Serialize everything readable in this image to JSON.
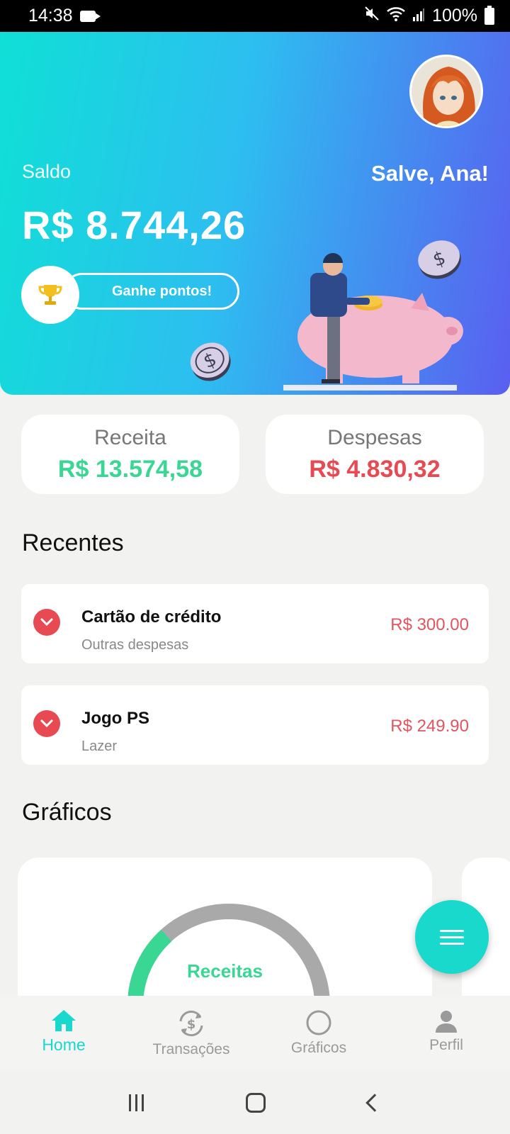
{
  "status": {
    "time": "14:38",
    "battery": "100%"
  },
  "header": {
    "balance_label": "Saldo",
    "greeting": "Salve, Ana!",
    "balance": "R$ 8.744,26",
    "points_button": "Ganhe pontos!"
  },
  "summary": {
    "income_label": "Receita",
    "income_value": "R$ 13.574,58",
    "expense_label": "Despesas",
    "expense_value": "R$ 4.830,32"
  },
  "recent": {
    "title": "Recentes",
    "items": [
      {
        "title": "Cartão de crédito",
        "category": "Outras despesas",
        "amount": "R$ 300.00"
      },
      {
        "title": "Jogo PS",
        "category": "Lazer",
        "amount": "R$ 249.90"
      }
    ]
  },
  "charts": {
    "title": "Gráficos",
    "gauge_label": "Receitas"
  },
  "nav": [
    "Home",
    "Transações",
    "Gráficos",
    "Perfil"
  ],
  "colors": {
    "accent": "#19d8cc",
    "income": "#3ad694",
    "expense": "#e84a53"
  }
}
